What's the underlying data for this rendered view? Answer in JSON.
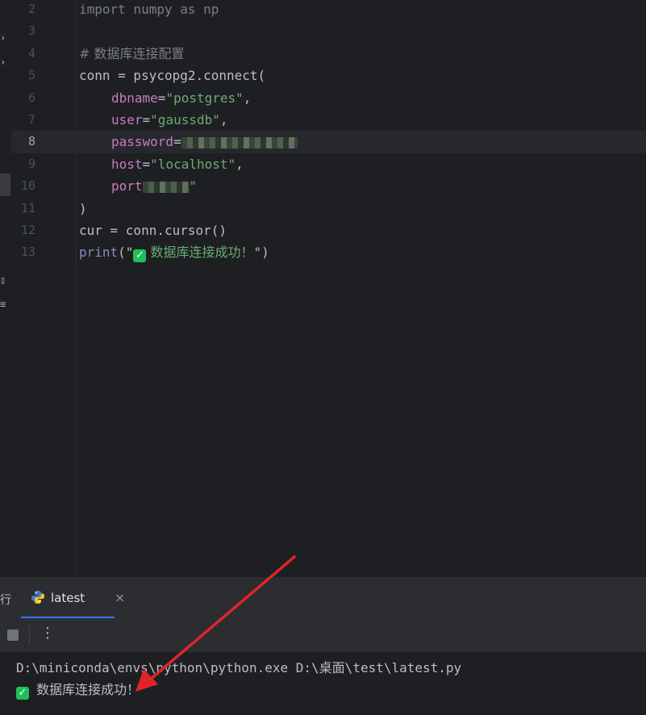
{
  "editor": {
    "lines": [
      {
        "n": "2",
        "code": "import numpy as np"
      },
      {
        "n": "3",
        "code": ""
      },
      {
        "n": "4",
        "code": "# 数据库连接配置"
      },
      {
        "n": "5",
        "code": "conn = psycopg2.connect("
      },
      {
        "n": "6",
        "param": "dbname",
        "value": "\"postgres\"",
        "tail": ","
      },
      {
        "n": "7",
        "param": "user",
        "value": "\"gaussdb\"",
        "tail": ","
      },
      {
        "n": "8",
        "param": "password",
        "value": "",
        "tail": ""
      },
      {
        "n": "9",
        "param": "host",
        "value": "\"localhost\"",
        "tail": ","
      },
      {
        "n": "10",
        "param": "port",
        "value": "\"",
        "tail": ""
      },
      {
        "n": "11",
        "code": ")"
      },
      {
        "n": "12",
        "code": "cur = conn.cursor()"
      },
      {
        "n": "13",
        "print_fn": "print",
        "print_open": "(\"",
        "print_text": " 数据库连接成功！",
        "print_close": "\")"
      }
    ],
    "current_line": "8"
  },
  "run_panel": {
    "partial_tab": "行",
    "tab_label": "latest",
    "close_glyph": "×",
    "more_glyph": "⋮"
  },
  "console": {
    "command": "D:\\miniconda\\envs\\python\\python.exe D:\\桌面\\test\\latest.py",
    "output": " 数据库连接成功！"
  },
  "colors": {
    "background": "#1e1f22",
    "keyword": "#cf8e6d",
    "string": "#6aab73",
    "param": "#c77dbb",
    "success": "#1fbf5a",
    "annotation_arrow": "#e0242b"
  }
}
